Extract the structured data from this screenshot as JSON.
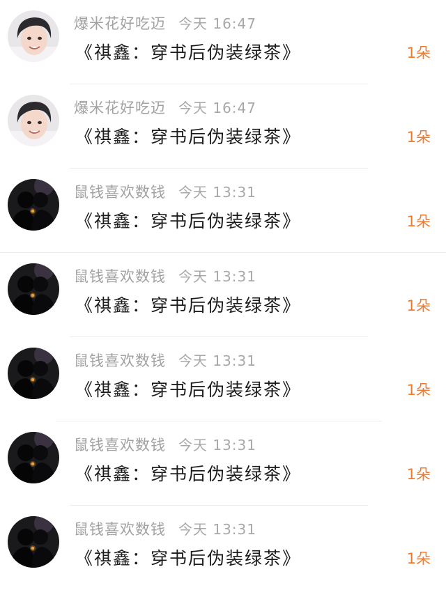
{
  "rows": [
    {
      "name": "爆米花好吃迈",
      "time": "今天 16:47",
      "message": "《祺鑫：穿书后伪装绿茶》",
      "count": "1朵",
      "avatar": "boy-photo"
    },
    {
      "name": "爆米花好吃迈",
      "time": "今天 16:47",
      "message": "《祺鑫：穿书后伪装绿茶》",
      "count": "1朵",
      "avatar": "boy-photo"
    },
    {
      "name": "鼠钱喜欢数钱",
      "time": "今天 13:31",
      "message": "《祺鑫：穿书后伪装绿茶》",
      "count": "1朵",
      "avatar": "silhouette-couple"
    },
    {
      "name": "鼠钱喜欢数钱",
      "time": "今天 13:31",
      "message": "《祺鑫：穿书后伪装绿茶》",
      "count": "1朵",
      "avatar": "silhouette-couple"
    },
    {
      "name": "鼠钱喜欢数钱",
      "time": "今天 13:31",
      "message": "《祺鑫：穿书后伪装绿茶》",
      "count": "1朵",
      "avatar": "silhouette-couple"
    },
    {
      "name": "鼠钱喜欢数钱",
      "time": "今天 13:31",
      "message": "《祺鑫：穿书后伪装绿茶》",
      "count": "1朵",
      "avatar": "silhouette-couple"
    },
    {
      "name": "鼠钱喜欢数钱",
      "time": "今天 13:31",
      "message": "《祺鑫：穿书后伪装绿茶》",
      "count": "1朵",
      "avatar": "silhouette-couple"
    }
  ],
  "colors": {
    "count": "#f07a2e",
    "name": "#a2a2a2",
    "message": "#1c1c1c"
  }
}
